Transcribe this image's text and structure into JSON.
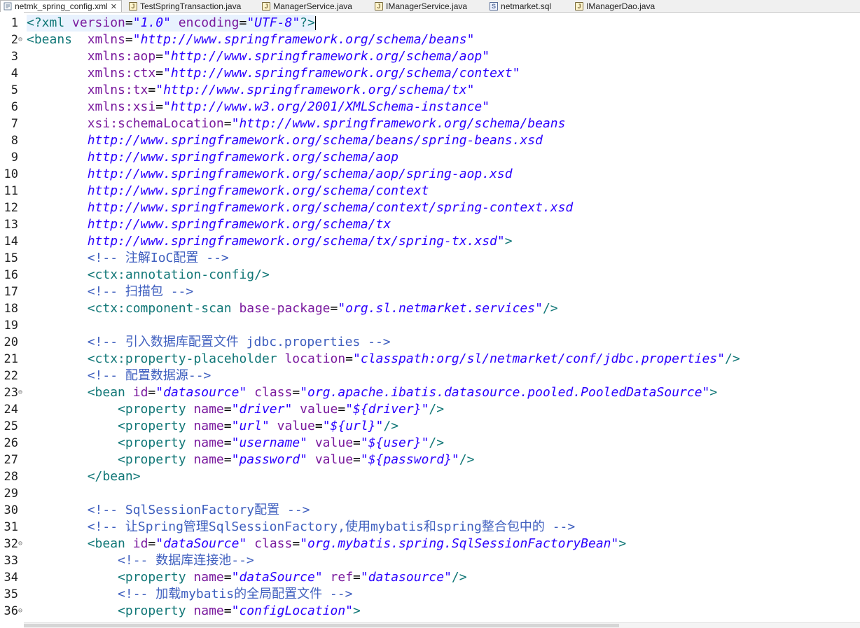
{
  "tabs": [
    {
      "label": "netmk_spring_config.xml",
      "icon": "xml-file-icon",
      "active": true
    },
    {
      "label": "TestSpringTransaction.java",
      "icon": "java-file-icon"
    },
    {
      "label": "ManagerService.java",
      "icon": "java-file-icon"
    },
    {
      "label": "IManagerService.java",
      "icon": "java-file-icon"
    },
    {
      "label": "netmarket.sql",
      "icon": "sql-file-icon"
    },
    {
      "label": "IManagerDao.java",
      "icon": "java-file-icon"
    }
  ],
  "close_glyph": "✕",
  "line_numbers": [
    "1",
    "2",
    "3",
    "4",
    "5",
    "6",
    "7",
    "8",
    "9",
    "10",
    "11",
    "12",
    "13",
    "14",
    "15",
    "16",
    "17",
    "18",
    "19",
    "20",
    "21",
    "22",
    "23",
    "24",
    "25",
    "26",
    "27",
    "28",
    "29",
    "30",
    "31",
    "32",
    "33",
    "34",
    "35",
    "36"
  ],
  "colors": {
    "tag": "#117777",
    "attribute": "#7a1a9e",
    "value": "#2a00ff",
    "comment": "#3f5fbf",
    "current_line": "#e8f2fe"
  },
  "code": [
    [
      [
        "pi",
        "<?xml "
      ],
      [
        "attr",
        "version"
      ],
      [
        "txt",
        "="
      ],
      [
        "val",
        "\"1.0\""
      ],
      [
        "txt",
        " "
      ],
      [
        "attr",
        "encoding"
      ],
      [
        "txt",
        "="
      ],
      [
        "val",
        "\"UTF-8\""
      ],
      [
        "pi",
        "?>"
      ]
    ],
    [
      [
        "tag",
        "<beans"
      ],
      [
        "txt",
        "  "
      ],
      [
        "attr",
        "xmlns"
      ],
      [
        "txt",
        "="
      ],
      [
        "val",
        "\"http://www.springframework.org/schema/beans\""
      ]
    ],
    [
      [
        "txt",
        "        "
      ],
      [
        "attr",
        "xmlns:aop"
      ],
      [
        "txt",
        "="
      ],
      [
        "val",
        "\"http://www.springframework.org/schema/aop\""
      ]
    ],
    [
      [
        "txt",
        "        "
      ],
      [
        "attr",
        "xmlns:ctx"
      ],
      [
        "txt",
        "="
      ],
      [
        "val",
        "\"http://www.springframework.org/schema/context\""
      ]
    ],
    [
      [
        "txt",
        "        "
      ],
      [
        "attr",
        "xmlns:tx"
      ],
      [
        "txt",
        "="
      ],
      [
        "val",
        "\"http://www.springframework.org/schema/tx\""
      ]
    ],
    [
      [
        "txt",
        "        "
      ],
      [
        "attr",
        "xmlns:xsi"
      ],
      [
        "txt",
        "="
      ],
      [
        "val",
        "\"http://www.w3.org/2001/XMLSchema-instance\""
      ]
    ],
    [
      [
        "txt",
        "        "
      ],
      [
        "attr",
        "xsi:schemaLocation"
      ],
      [
        "txt",
        "="
      ],
      [
        "val",
        "\"http://www.springframework.org/schema/beans"
      ]
    ],
    [
      [
        "txt",
        "        "
      ],
      [
        "val",
        "http://www.springframework.org/schema/beans/spring-beans.xsd"
      ]
    ],
    [
      [
        "txt",
        "        "
      ],
      [
        "val",
        "http://www.springframework.org/schema/aop"
      ]
    ],
    [
      [
        "txt",
        "        "
      ],
      [
        "val",
        "http://www.springframework.org/schema/aop/spring-aop.xsd"
      ]
    ],
    [
      [
        "txt",
        "        "
      ],
      [
        "val",
        "http://www.springframework.org/schema/context"
      ]
    ],
    [
      [
        "txt",
        "        "
      ],
      [
        "val",
        "http://www.springframework.org/schema/context/spring-context.xsd"
      ]
    ],
    [
      [
        "txt",
        "        "
      ],
      [
        "val",
        "http://www.springframework.org/schema/tx"
      ]
    ],
    [
      [
        "txt",
        "        "
      ],
      [
        "val",
        "http://www.springframework.org/schema/tx/spring-tx.xsd\""
      ],
      [
        "tag",
        ">"
      ]
    ],
    [
      [
        "txt",
        "        "
      ],
      [
        "cmt",
        "<!-- 注解IoC配置 -->"
      ]
    ],
    [
      [
        "txt",
        "        "
      ],
      [
        "tag",
        "<ctx:annotation-config/>"
      ]
    ],
    [
      [
        "txt",
        "        "
      ],
      [
        "cmt",
        "<!-- 扫描包 -->"
      ]
    ],
    [
      [
        "txt",
        "        "
      ],
      [
        "tag",
        "<ctx:component-scan "
      ],
      [
        "attr",
        "base-package"
      ],
      [
        "txt",
        "="
      ],
      [
        "val",
        "\"org.sl.netmarket.services\""
      ],
      [
        "tag",
        "/>"
      ]
    ],
    [],
    [
      [
        "txt",
        "        "
      ],
      [
        "cmt",
        "<!-- 引入数据库配置文件 jdbc.properties -->"
      ]
    ],
    [
      [
        "txt",
        "        "
      ],
      [
        "tag",
        "<ctx:property-placeholder "
      ],
      [
        "attr",
        "location"
      ],
      [
        "txt",
        "="
      ],
      [
        "val",
        "\"classpath:org/sl/netmarket/conf/jdbc.properties\""
      ],
      [
        "tag",
        "/>"
      ]
    ],
    [
      [
        "txt",
        "        "
      ],
      [
        "cmt",
        "<!-- 配置数据源-->"
      ]
    ],
    [
      [
        "txt",
        "        "
      ],
      [
        "tag",
        "<bean "
      ],
      [
        "attr",
        "id"
      ],
      [
        "txt",
        "="
      ],
      [
        "val",
        "\"datasource\""
      ],
      [
        "txt",
        " "
      ],
      [
        "attr",
        "class"
      ],
      [
        "txt",
        "="
      ],
      [
        "val",
        "\"org.apache.ibatis.datasource.pooled.PooledDataSource\""
      ],
      [
        "tag",
        ">"
      ]
    ],
    [
      [
        "txt",
        "            "
      ],
      [
        "tag",
        "<property "
      ],
      [
        "attr",
        "name"
      ],
      [
        "txt",
        "="
      ],
      [
        "val",
        "\"driver\""
      ],
      [
        "txt",
        " "
      ],
      [
        "attr",
        "value"
      ],
      [
        "txt",
        "="
      ],
      [
        "val",
        "\"${driver}\""
      ],
      [
        "tag",
        "/>"
      ]
    ],
    [
      [
        "txt",
        "            "
      ],
      [
        "tag",
        "<property "
      ],
      [
        "attr",
        "name"
      ],
      [
        "txt",
        "="
      ],
      [
        "val",
        "\"url\""
      ],
      [
        "txt",
        " "
      ],
      [
        "attr",
        "value"
      ],
      [
        "txt",
        "="
      ],
      [
        "val",
        "\"${url}\""
      ],
      [
        "tag",
        "/>"
      ]
    ],
    [
      [
        "txt",
        "            "
      ],
      [
        "tag",
        "<property "
      ],
      [
        "attr",
        "name"
      ],
      [
        "txt",
        "="
      ],
      [
        "val",
        "\"username\""
      ],
      [
        "txt",
        " "
      ],
      [
        "attr",
        "value"
      ],
      [
        "txt",
        "="
      ],
      [
        "val",
        "\"${user}\""
      ],
      [
        "tag",
        "/>"
      ]
    ],
    [
      [
        "txt",
        "            "
      ],
      [
        "tag",
        "<property "
      ],
      [
        "attr",
        "name"
      ],
      [
        "txt",
        "="
      ],
      [
        "val",
        "\"password\""
      ],
      [
        "txt",
        " "
      ],
      [
        "attr",
        "value"
      ],
      [
        "txt",
        "="
      ],
      [
        "val",
        "\"${password}\""
      ],
      [
        "tag",
        "/>"
      ]
    ],
    [
      [
        "txt",
        "        "
      ],
      [
        "tag",
        "</bean>"
      ]
    ],
    [],
    [
      [
        "txt",
        "        "
      ],
      [
        "cmt",
        "<!-- SqlSessionFactory配置 -->"
      ]
    ],
    [
      [
        "txt",
        "        "
      ],
      [
        "cmt",
        "<!-- 让Spring管理SqlSessionFactory,使用mybatis和spring整合包中的 -->"
      ]
    ],
    [
      [
        "txt",
        "        "
      ],
      [
        "tag",
        "<bean "
      ],
      [
        "attr",
        "id"
      ],
      [
        "txt",
        "="
      ],
      [
        "val",
        "\"dataSource\""
      ],
      [
        "txt",
        " "
      ],
      [
        "attr",
        "class"
      ],
      [
        "txt",
        "="
      ],
      [
        "val",
        "\"org.mybatis.spring.SqlSessionFactoryBean\""
      ],
      [
        "tag",
        ">"
      ]
    ],
    [
      [
        "txt",
        "            "
      ],
      [
        "cmt",
        "<!-- 数据库连接池-->"
      ]
    ],
    [
      [
        "txt",
        "            "
      ],
      [
        "tag",
        "<property "
      ],
      [
        "attr",
        "name"
      ],
      [
        "txt",
        "="
      ],
      [
        "val",
        "\"dataSource\""
      ],
      [
        "txt",
        " "
      ],
      [
        "attr",
        "ref"
      ],
      [
        "txt",
        "="
      ],
      [
        "val",
        "\"datasource\""
      ],
      [
        "tag",
        "/>"
      ]
    ],
    [
      [
        "txt",
        "            "
      ],
      [
        "cmt",
        "<!-- 加载mybatis的全局配置文件 -->"
      ]
    ],
    [
      [
        "txt",
        "            "
      ],
      [
        "tag",
        "<property "
      ],
      [
        "attr",
        "name"
      ],
      [
        "txt",
        "="
      ],
      [
        "val",
        "\"configLocation\""
      ],
      [
        "tag",
        ">"
      ]
    ]
  ],
  "folded_lines": [
    2,
    23,
    32,
    36
  ],
  "current_line": 1
}
